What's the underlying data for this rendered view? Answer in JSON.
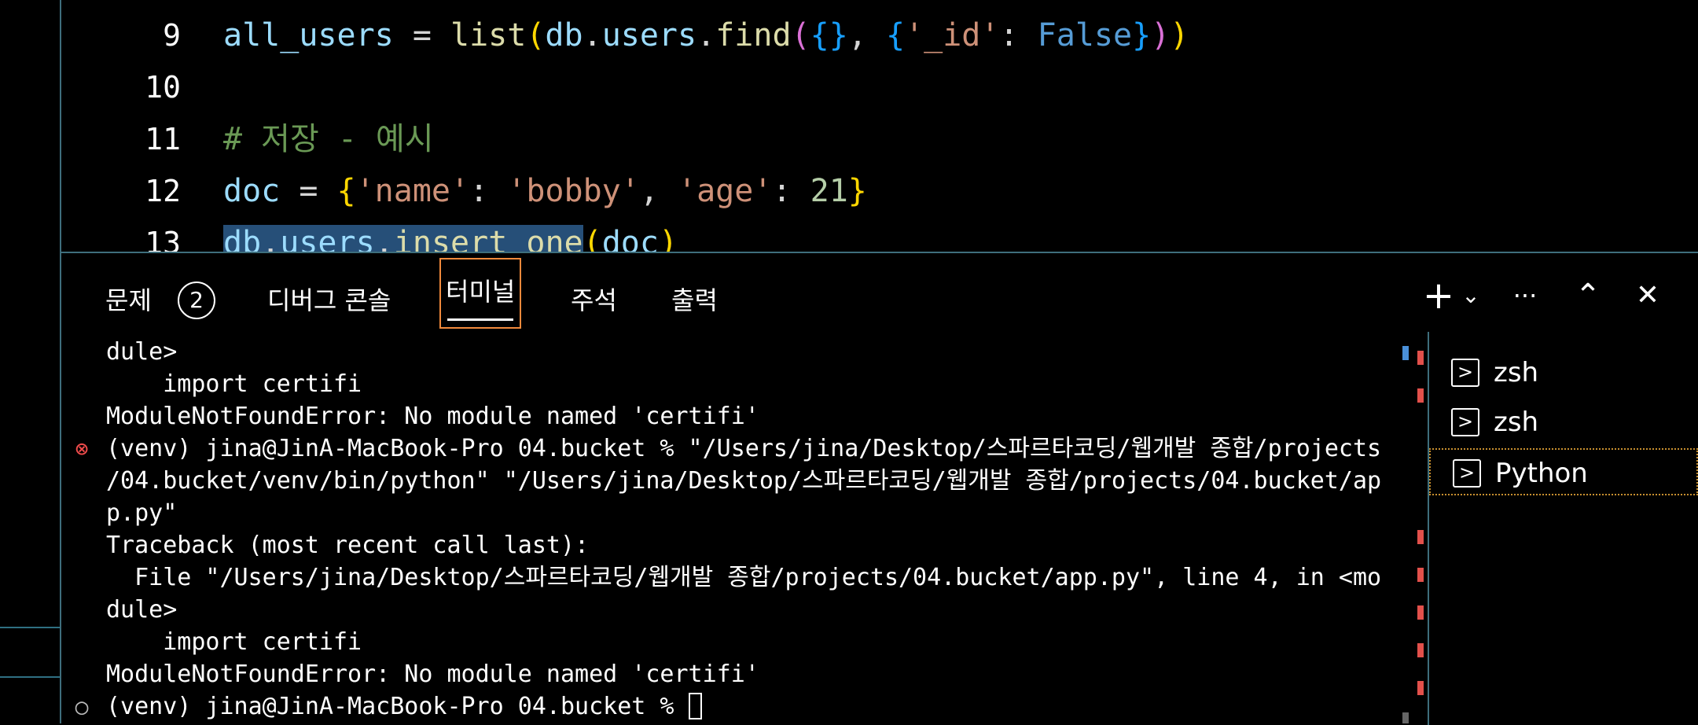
{
  "editor": {
    "lines": [
      {
        "num": "9",
        "tokens": [
          {
            "t": "all_users",
            "c": "t-var"
          },
          {
            "t": " = ",
            "c": "t-op"
          },
          {
            "t": "list",
            "c": "t-fn"
          },
          {
            "t": "(",
            "c": "t-br1"
          },
          {
            "t": "db",
            "c": "t-var"
          },
          {
            "t": ".",
            "c": "t-op"
          },
          {
            "t": "users",
            "c": "t-var"
          },
          {
            "t": ".",
            "c": "t-op"
          },
          {
            "t": "find",
            "c": "t-fn"
          },
          {
            "t": "(",
            "c": "t-br2"
          },
          {
            "t": "{}",
            "c": "t-br3"
          },
          {
            "t": ", ",
            "c": "t-op"
          },
          {
            "t": "{",
            "c": "t-br3"
          },
          {
            "t": "'_id'",
            "c": "t-str"
          },
          {
            "t": ": ",
            "c": "t-op"
          },
          {
            "t": "False",
            "c": "t-kw"
          },
          {
            "t": "}",
            "c": "t-br3"
          },
          {
            "t": ")",
            "c": "t-br2"
          },
          {
            "t": ")",
            "c": "t-br1"
          }
        ]
      },
      {
        "num": "10",
        "tokens": []
      },
      {
        "num": "11",
        "tokens": [
          {
            "t": "# 저장 - 예시",
            "c": "t-cmt"
          }
        ]
      },
      {
        "num": "12",
        "tokens": [
          {
            "t": "doc",
            "c": "t-var"
          },
          {
            "t": " = ",
            "c": "t-op"
          },
          {
            "t": "{",
            "c": "t-br1"
          },
          {
            "t": "'name'",
            "c": "t-str"
          },
          {
            "t": ": ",
            "c": "t-op"
          },
          {
            "t": "'bobby'",
            "c": "t-str"
          },
          {
            "t": ", ",
            "c": "t-op"
          },
          {
            "t": "'age'",
            "c": "t-str"
          },
          {
            "t": ": ",
            "c": "t-op"
          },
          {
            "t": "21",
            "c": "t-num"
          },
          {
            "t": "}",
            "c": "t-br1"
          }
        ]
      },
      {
        "num": "13",
        "tokens": [
          {
            "t": "db",
            "c": "t-var sel"
          },
          {
            "t": ".",
            "c": "t-op sel"
          },
          {
            "t": "users",
            "c": "t-var sel"
          },
          {
            "t": ".",
            "c": "t-op sel"
          },
          {
            "t": "insert_one",
            "c": "t-fn sel"
          },
          {
            "t": "(",
            "c": "t-br1"
          },
          {
            "t": "doc",
            "c": "t-var"
          },
          {
            "t": ")",
            "c": "t-br1"
          }
        ]
      }
    ]
  },
  "panel": {
    "tabs": {
      "problems": "문제",
      "problems_count": "2",
      "debug_console": "디버그 콘솔",
      "terminal": "터미널",
      "comments": "주석",
      "output": "출력"
    },
    "toolbar": {
      "new_terminal": "+",
      "dropdown": "⌄",
      "more": "···",
      "maximize": "⌃",
      "close": "✕"
    }
  },
  "terminal": {
    "lines": [
      {
        "text": "dule>",
        "mark": ""
      },
      {
        "text": "    import certifi",
        "mark": ""
      },
      {
        "text": "ModuleNotFoundError: No module named 'certifi'",
        "mark": ""
      },
      {
        "text": "(venv) jina@JinA-MacBook-Pro 04.bucket % \"/Users/jina/Desktop/스파르타코딩/웹개발 종합/projects",
        "mark": "error"
      },
      {
        "text": "/04.bucket/venv/bin/python\" \"/Users/jina/Desktop/스파르타코딩/웹개발 종합/projects/04.bucket/ap",
        "mark": ""
      },
      {
        "text": "p.py\"",
        "mark": ""
      },
      {
        "text": "Traceback (most recent call last):",
        "mark": ""
      },
      {
        "text": "  File \"/Users/jina/Desktop/스파르타코딩/웹개발 종합/projects/04.bucket/app.py\", line 4, in <mo",
        "mark": ""
      },
      {
        "text": "dule>",
        "mark": ""
      },
      {
        "text": "    import certifi",
        "mark": ""
      },
      {
        "text": "ModuleNotFoundError: No module named 'certifi'",
        "mark": ""
      },
      {
        "text": "(venv) jina@JinA-MacBook-Pro 04.bucket % ",
        "mark": "idle",
        "cursor": true
      }
    ],
    "marks": {
      "error": "⊗",
      "idle": "○"
    },
    "colors": {
      "error": "#f14c4c",
      "idle": "#bbbbbb"
    }
  },
  "terminal_list": {
    "items": [
      {
        "label": "zsh",
        "icon": ">"
      },
      {
        "label": "zsh",
        "icon": ">"
      },
      {
        "label": "Python",
        "icon": ">",
        "selected": true
      }
    ]
  }
}
